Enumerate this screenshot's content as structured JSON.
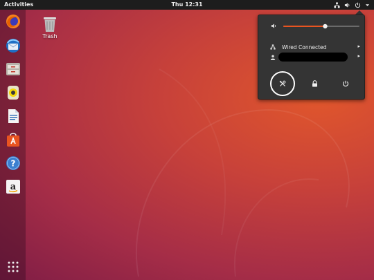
{
  "topbar": {
    "activities_label": "Activities",
    "clock": "Thu 12:31",
    "icons": [
      "network-icon",
      "volume-icon",
      "power-icon",
      "caret-down-icon"
    ]
  },
  "dock": {
    "apps": [
      {
        "name": "firefox",
        "icon": "firefox-icon"
      },
      {
        "name": "thunderbird",
        "icon": "thunderbird-icon"
      },
      {
        "name": "files",
        "icon": "files-icon"
      },
      {
        "name": "rhythmbox",
        "icon": "rhythmbox-icon"
      },
      {
        "name": "libreoffice-writer",
        "icon": "writer-icon"
      },
      {
        "name": "ubuntu-software",
        "icon": "software-icon"
      },
      {
        "name": "help",
        "icon": "help-icon"
      },
      {
        "name": "amazon",
        "icon": "amazon-icon"
      }
    ],
    "show_apps_icon": "grid-icon"
  },
  "desktop": {
    "trash_label": "Trash"
  },
  "system_menu": {
    "volume_level": 0.55,
    "network_label": "Wired Connected",
    "user_label": "",
    "buttons": [
      "settings-icon",
      "lock-icon",
      "power-icon"
    ]
  },
  "colors": {
    "topbar_bg": "#1d1d1d",
    "menu_bg": "#343434",
    "accent_orange": "#e95420"
  }
}
